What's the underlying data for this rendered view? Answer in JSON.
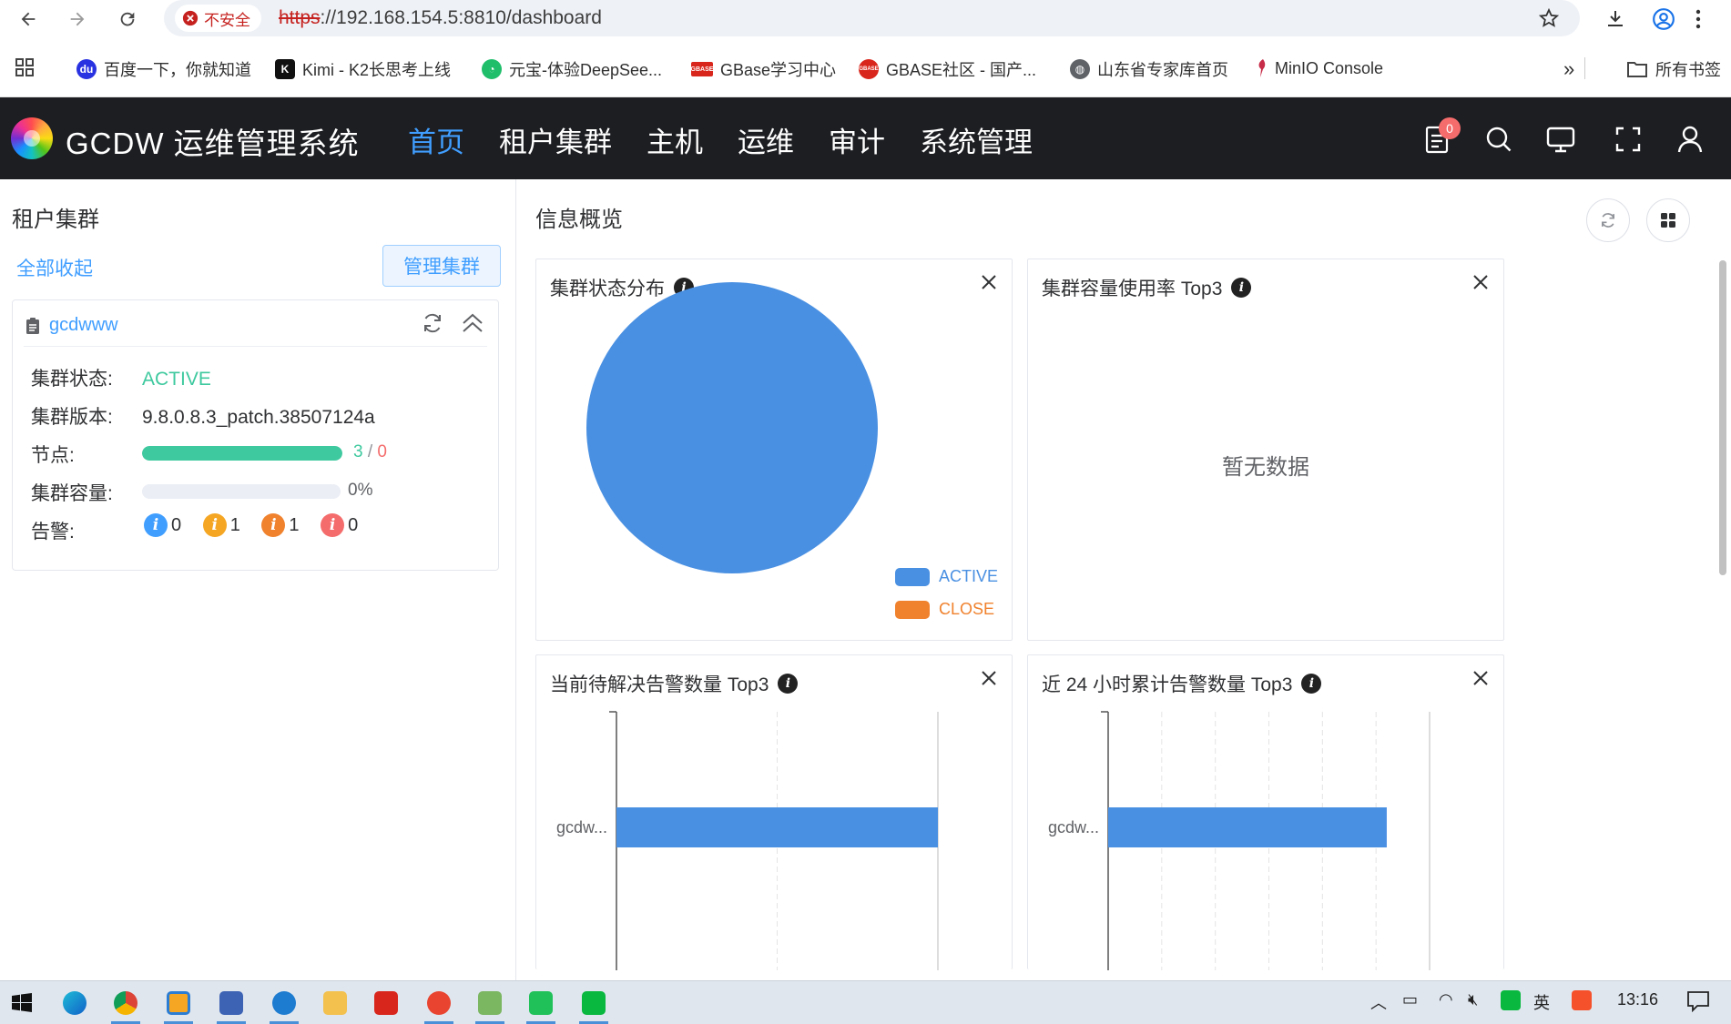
{
  "browser": {
    "insecure_label": "不安全",
    "url_scheme": "https",
    "url_rest": "://192.168.154.5:8810/dashboard",
    "bookmarks": [
      {
        "label": "百度一下，你就知道",
        "color": "#2932e1"
      },
      {
        "label": "Kimi - K2长思考上线",
        "color": "#111111"
      },
      {
        "label": "元宝-体验DeepSee...",
        "color": "#1fbe6b"
      },
      {
        "label": "GBase学习中心",
        "color": "#d9261c"
      },
      {
        "label": "GBASE社区 - 国产...",
        "color": "#d9261c"
      },
      {
        "label": "山东省专家库首页",
        "color": "#5f6368"
      },
      {
        "label": "MinIO Console",
        "color": "#c72c48"
      }
    ],
    "all_bookmarks_label": "所有书签",
    "overflow_label": "»"
  },
  "app": {
    "title": "GCDW 运维管理系统",
    "nav": [
      "首页",
      "租户集群",
      "主机",
      "运维",
      "审计",
      "系统管理"
    ],
    "notification_count": "0"
  },
  "left": {
    "title": "租户集群",
    "collapse_all": "全部收起",
    "manage_button": "管理集群",
    "cluster": {
      "name": "gcdwww",
      "status_label": "集群状态:",
      "status_value": "ACTIVE",
      "version_label": "集群版本:",
      "version_value": "9.8.0.8.3_patch.38507124a",
      "nodes_label": "节点:",
      "nodes_up": "3",
      "nodes_sep": "/",
      "nodes_down": "0",
      "nodes_fill": 1.0,
      "capacity_label": "集群容量:",
      "capacity_value": "0%",
      "capacity_fill": 0.0,
      "alerts_label": "告警:",
      "alerts": [
        {
          "count": "0",
          "color": "#409eff"
        },
        {
          "count": "1",
          "color": "#f5a623"
        },
        {
          "count": "1",
          "color": "#f0822e"
        },
        {
          "count": "0",
          "color": "#f56c6c"
        }
      ]
    }
  },
  "overview": {
    "title": "信息概览",
    "widgets": {
      "status_dist": {
        "title": "集群状态分布"
      },
      "capacity_top3": {
        "title": "集群容量使用率 Top3",
        "empty_text": "暂无数据"
      },
      "pending_alerts_top3": {
        "title": "当前待解决告警数量 Top3"
      },
      "alerts_24h_top3": {
        "title": "近 24 小时累计告警数量 Top3"
      }
    }
  },
  "chart_data": [
    {
      "type": "pie",
      "title": "集群状态分布",
      "labels": [
        "ACTIVE",
        "CLOSE"
      ],
      "values": [
        1,
        0
      ],
      "colors": [
        "#4a90e2",
        "#f0822e"
      ],
      "legend": "bottom-right"
    },
    {
      "type": "bar",
      "orientation": "horizontal",
      "title": "当前待解决告警数量 Top3",
      "categories": [
        "gcdw..."
      ],
      "values": [
        2
      ],
      "xlim": [
        0,
        2
      ],
      "color": "#4a90e2",
      "grid": true
    },
    {
      "type": "bar",
      "orientation": "horizontal",
      "title": "近 24 小时累计告警数量 Top3",
      "categories": [
        "gcdw..."
      ],
      "values": [
        5.2
      ],
      "xlim": [
        0,
        6
      ],
      "color": "#4a90e2",
      "grid": true
    }
  ],
  "taskbar": {
    "ime_label": "英",
    "clock": "13:16"
  }
}
